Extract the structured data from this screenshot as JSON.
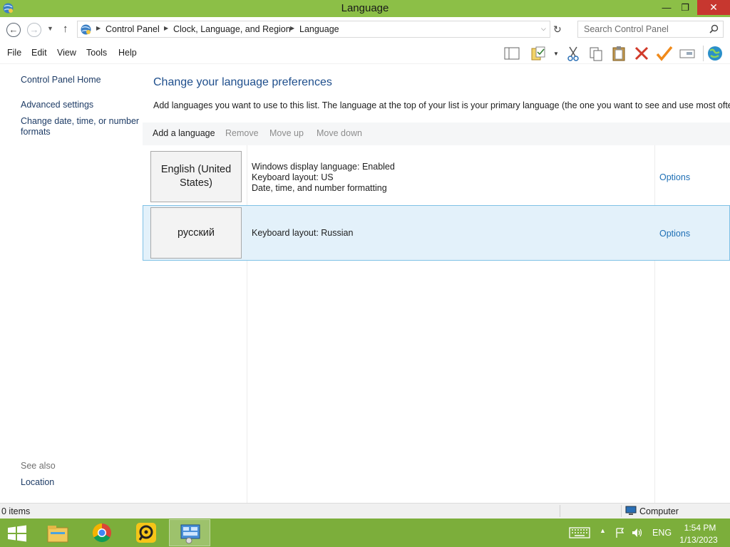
{
  "window": {
    "title": "Language",
    "minimize_glyph": "—",
    "maximize_glyph": "❐",
    "close_glyph": "✕"
  },
  "address": {
    "breadcrumbs": [
      "Control Panel",
      "Clock, Language, and Region",
      "Language"
    ],
    "search_placeholder": "Search Control Panel"
  },
  "menu": {
    "items": [
      "File",
      "Edit",
      "View",
      "Tools",
      "Help"
    ]
  },
  "toolbar": {
    "icons": [
      "layout-pane-icon",
      "properties-icon",
      "cut-icon",
      "copy-icon",
      "paste-icon",
      "delete-icon",
      "checkmark-icon",
      "rename-icon",
      "globe-icon"
    ]
  },
  "sidebar": {
    "home": "Control Panel Home",
    "links": [
      "Advanced settings",
      "Change date, time, or number formats"
    ],
    "see_also_label": "See also",
    "see_also_links": [
      "Location"
    ]
  },
  "main": {
    "heading": "Change your language preferences",
    "description": "Add languages you want to use to this list. The language at the top of your list is your primary language (the one you want to see and use most often).",
    "actions": {
      "add": "Add a language",
      "remove": "Remove",
      "move_up": "Move up",
      "move_down": "Move down"
    },
    "languages": [
      {
        "name": "English (United States)",
        "details": [
          "Windows display language: Enabled",
          "Keyboard layout: US",
          "Date, time, and number formatting"
        ],
        "options": "Options",
        "selected": false
      },
      {
        "name": "русский",
        "details": [
          "Keyboard layout: Russian"
        ],
        "options": "Options",
        "selected": true
      }
    ]
  },
  "status": {
    "items_count": "0 items",
    "zone": "Computer"
  },
  "taskbar": {
    "apps": [
      "file-explorer",
      "chrome",
      "anydesk-like-app",
      "control-panel"
    ],
    "language": "ENG",
    "time": "1:54 PM",
    "date": "1/13/2023"
  },
  "colors": {
    "titlebar": "#8cbf47",
    "taskbar": "#7cae3b",
    "heading": "#1e4e8c",
    "link": "#1e6fb5",
    "selection_bg": "#e3f1fa",
    "selection_border": "#7fc1e6",
    "close_button": "#c7372f"
  }
}
